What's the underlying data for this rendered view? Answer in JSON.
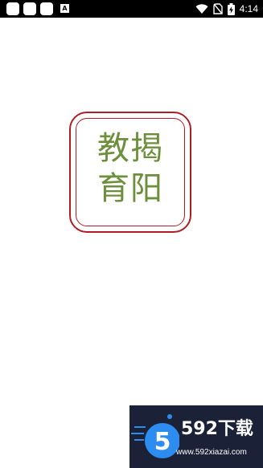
{
  "status_bar": {
    "badge": "A",
    "time": "4:14",
    "icons": [
      "notification-square-icon",
      "notification-square-icon",
      "notification-square-icon",
      "a-badge-icon",
      "wifi-icon",
      "no-sim-icon",
      "battery-charging-icon"
    ]
  },
  "logo": {
    "line1": "教揭",
    "line2": "育阳",
    "border_color": "#b11c25",
    "text_color": "#6b8f3a"
  },
  "watermark": {
    "brand": "592下载",
    "url": "www.592xiazai.com",
    "background": "#1b2238",
    "accent": "#2d8cf0"
  }
}
